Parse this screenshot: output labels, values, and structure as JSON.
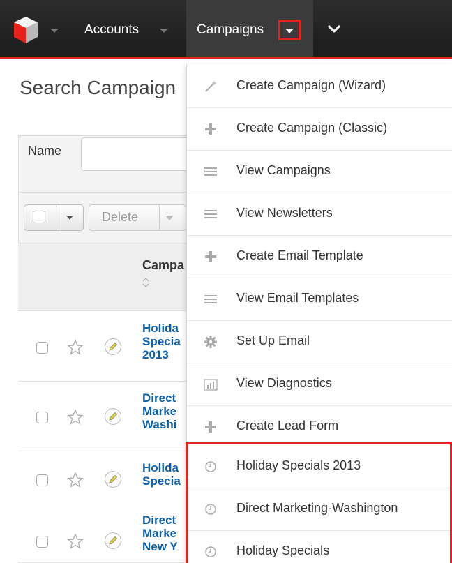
{
  "topnav": {
    "accounts_label": "Accounts",
    "campaigns_label": "Campaigns",
    "accent_color": "#e8211a"
  },
  "page": {
    "title": "Search Campaign"
  },
  "filter": {
    "name_label": "Name",
    "name_value": ""
  },
  "actions": {
    "delete_label": "Delete"
  },
  "table": {
    "column_header": "Campa",
    "rows": [
      {
        "name": "Holida\nSpecia\n2013"
      },
      {
        "name": "Direct\nMarke\nWashi"
      },
      {
        "name": "Holida\nSpecia"
      },
      {
        "name": "Direct\nMarke\nNew Y"
      }
    ]
  },
  "menu": {
    "items": [
      {
        "label": "Create Campaign (Wizard)",
        "icon": "wand-icon"
      },
      {
        "label": "Create Campaign (Classic)",
        "icon": "plus-icon"
      },
      {
        "label": "View Campaigns",
        "icon": "list-icon"
      },
      {
        "label": "View Newsletters",
        "icon": "list-icon"
      },
      {
        "label": "Create Email Template",
        "icon": "plus-icon"
      },
      {
        "label": "View Email Templates",
        "icon": "list-icon"
      },
      {
        "label": "Set Up Email",
        "icon": "gear-icon"
      },
      {
        "label": "View Diagnostics",
        "icon": "bar-chart-icon"
      },
      {
        "label": "Create Lead Form",
        "icon": "plus-icon"
      }
    ],
    "recent": [
      {
        "label": "Holiday Specials 2013",
        "icon": "clock-icon"
      },
      {
        "label": "Direct Marketing-Washington",
        "icon": "clock-icon"
      },
      {
        "label": "Holiday Specials",
        "icon": "clock-icon"
      }
    ]
  }
}
